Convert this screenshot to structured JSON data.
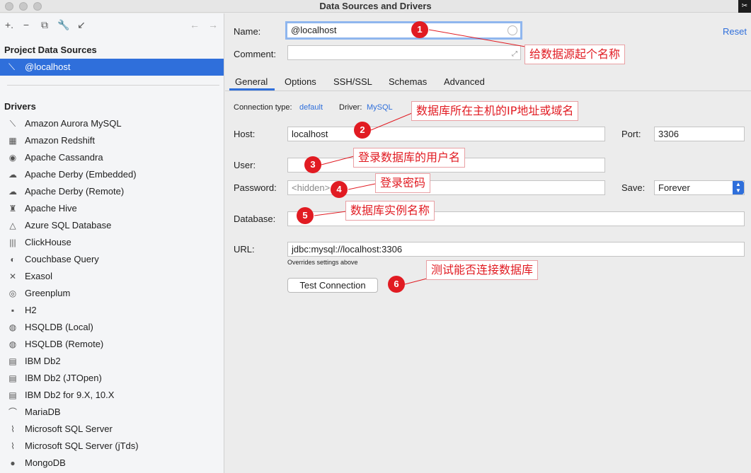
{
  "window": {
    "title": "Data Sources and Drivers"
  },
  "sidebar": {
    "toolbar": {
      "add_icon": "+.",
      "remove_icon": "−",
      "copy_icon": "⧉",
      "wrench_icon": "🔧",
      "goto_icon": "↙",
      "back_icon": "←",
      "forward_icon": "→"
    },
    "project_header": "Project Data Sources",
    "selected_source": "@localhost",
    "drivers_header": "Drivers",
    "drivers": [
      "Amazon Aurora MySQL",
      "Amazon Redshift",
      "Apache Cassandra",
      "Apache Derby (Embedded)",
      "Apache Derby (Remote)",
      "Apache Hive",
      "Azure SQL Database",
      "ClickHouse",
      "Couchbase Query",
      "Exasol",
      "Greenplum",
      "H2",
      "HSQLDB (Local)",
      "HSQLDB (Remote)",
      "IBM Db2",
      "IBM Db2 (JTOpen)",
      "IBM Db2 for 9.X, 10.X",
      "MariaDB",
      "Microsoft SQL Server",
      "Microsoft SQL Server (jTds)",
      "MongoDB"
    ],
    "driver_icons": [
      "⟍",
      "▦",
      "◉",
      "☁",
      "☁",
      "♜",
      "△",
      "|||",
      "◐",
      "✕",
      "◎",
      "▪",
      "◍",
      "◍",
      "▤",
      "▤",
      "▤",
      "⌒",
      "⌇",
      "⌇",
      "●"
    ]
  },
  "form": {
    "name_label": "Name:",
    "name_value": "@localhost",
    "comment_label": "Comment:",
    "comment_value": "",
    "reset_label": "Reset",
    "tabs": [
      "General",
      "Options",
      "SSH/SSL",
      "Schemas",
      "Advanced"
    ],
    "connection_type_label": "Connection type:",
    "connection_type_value": "default",
    "driver_label": "Driver:",
    "driver_value": "MySQL",
    "host_label": "Host:",
    "host_value": "localhost",
    "port_label": "Port:",
    "port_value": "3306",
    "user_label": "User:",
    "user_value": "",
    "password_label": "Password:",
    "password_placeholder": "<hidden>",
    "save_label": "Save:",
    "save_value": "Forever",
    "database_label": "Database:",
    "database_value": "",
    "url_label": "URL:",
    "url_value": "jdbc:mysql://localhost:3306",
    "url_hint": "Overrides settings above",
    "test_connection_label": "Test Connection"
  },
  "annotations": [
    {
      "number": "1",
      "text": "给数据源起个名称"
    },
    {
      "number": "2",
      "text": "数据库所在主机的IP地址或域名"
    },
    {
      "number": "3",
      "text": "登录数据库的用户名"
    },
    {
      "number": "4",
      "text": "登录密码"
    },
    {
      "number": "5",
      "text": "数据库实例名称"
    },
    {
      "number": "6",
      "text": "测试能否连接数据库"
    }
  ],
  "colors": {
    "accent": "#2f6fdb",
    "annotation_red": "#e11b22"
  }
}
